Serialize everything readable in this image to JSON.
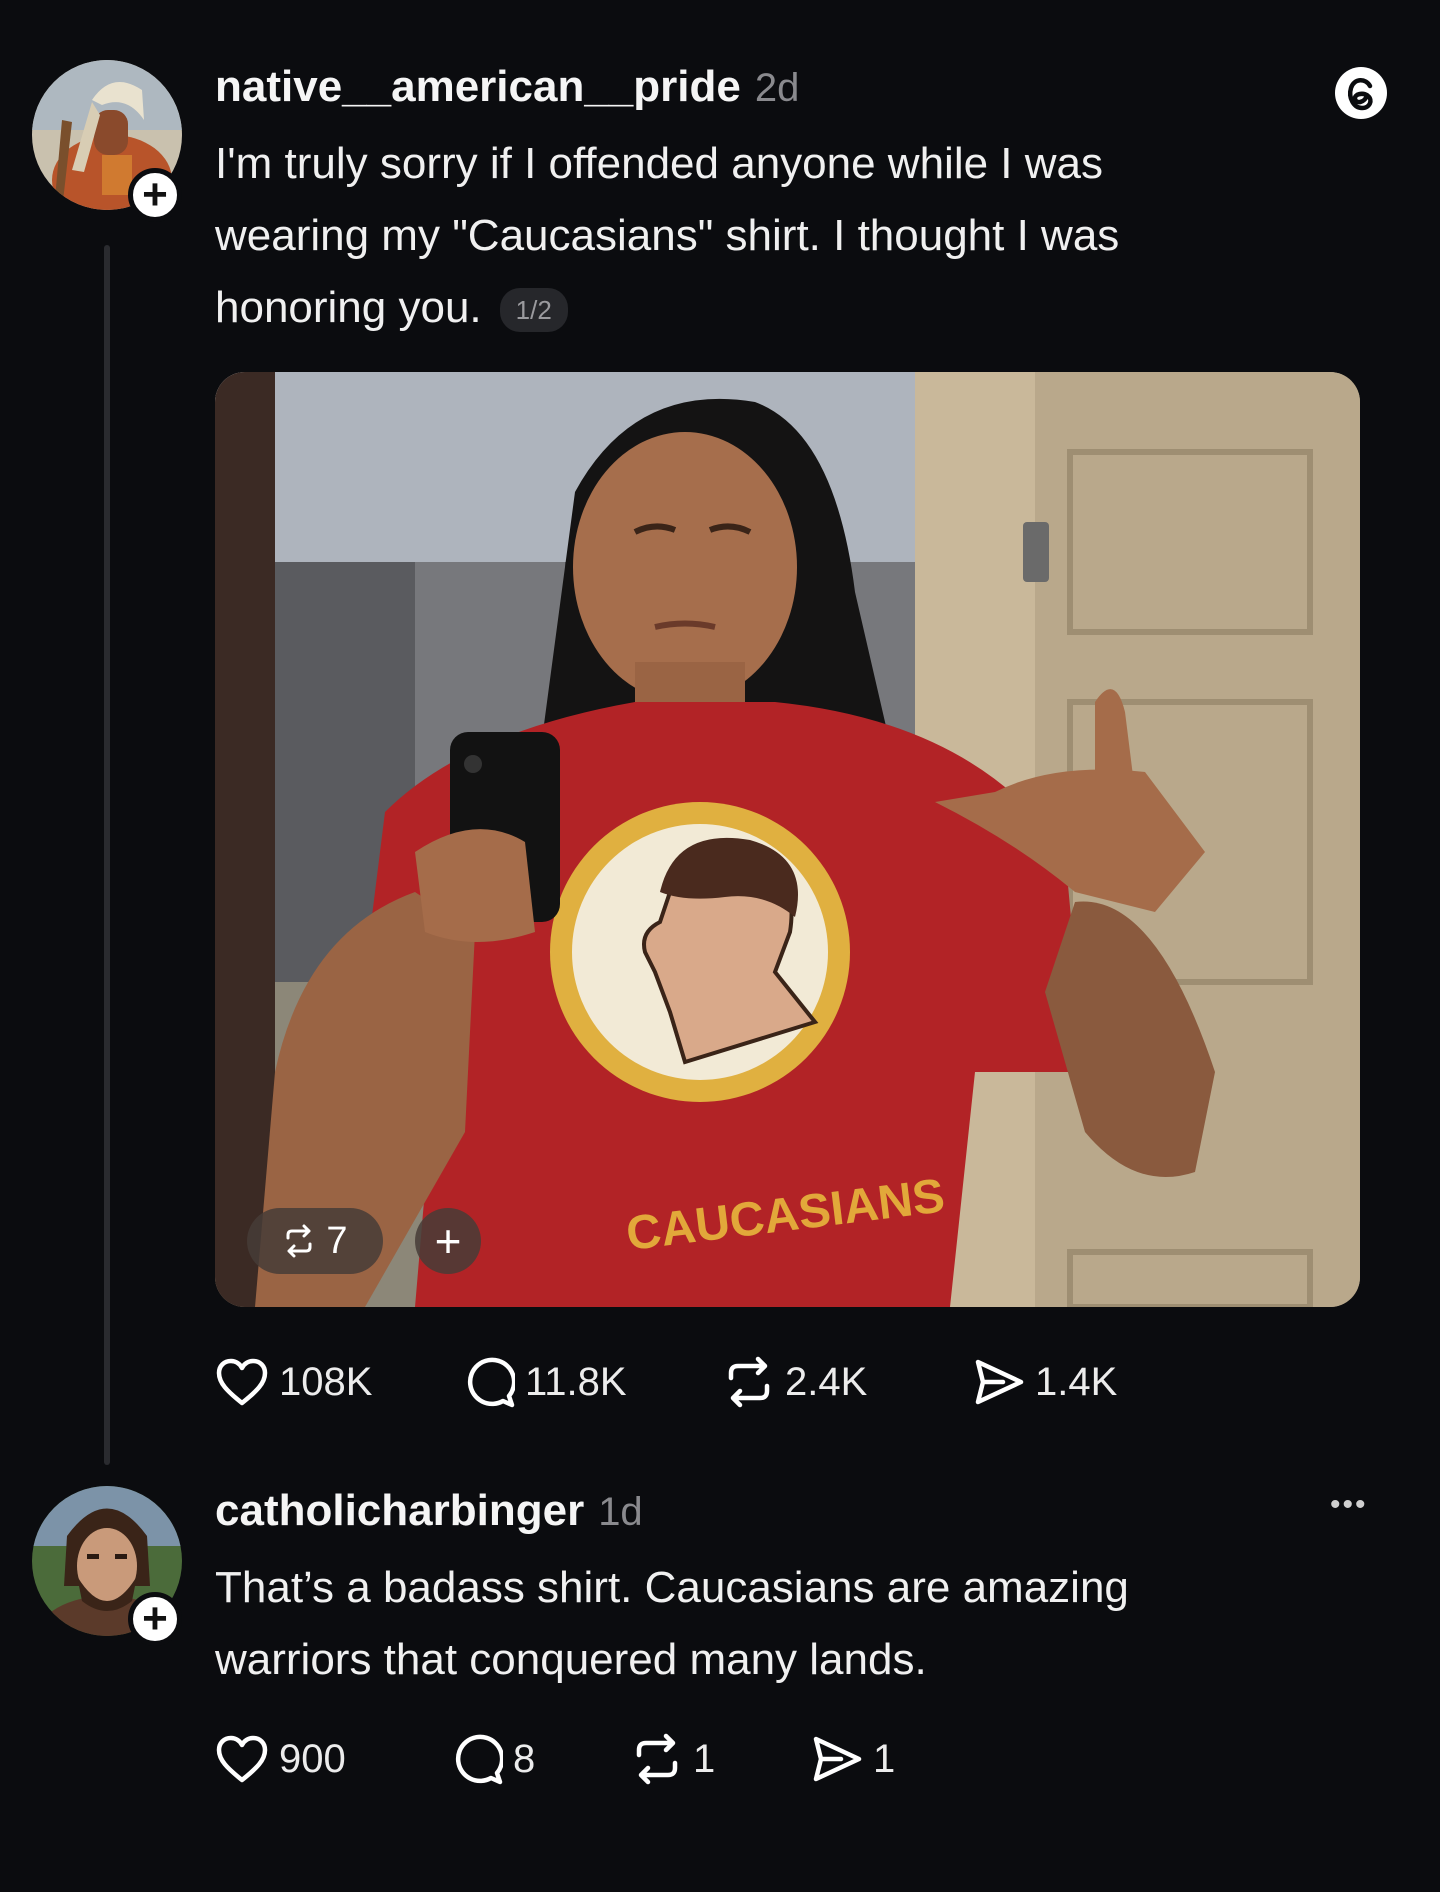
{
  "post": {
    "username": "native__american__pride",
    "time": "2d",
    "text_lines": [
      "I'm truly sorry if I offended anyone while I was",
      "wearing my \"Caucasians\" shirt. I thought I was",
      "honoring you."
    ],
    "page_indicator": "1/2",
    "shirt_text": "CAUCASIANS",
    "media_repost_count": "7",
    "media_add_label": "+",
    "stats": {
      "likes": "108K",
      "replies": "11.8K",
      "reposts": "2.4K",
      "shares": "1.4K"
    }
  },
  "reply": {
    "username": "catholicharbinger",
    "time": "1d",
    "text_lines": [
      "That’s a badass shirt. Caucasians are amazing",
      "warriors that conquered many lands."
    ],
    "more_label": "•••",
    "stats": {
      "likes": "900",
      "replies": "8",
      "reposts": "1",
      "shares": "1"
    }
  },
  "follow_badge_label": "+",
  "icons": {
    "app": "threads-logo-icon",
    "like": "heart-icon",
    "reply": "comment-icon",
    "repost": "repost-icon",
    "share": "send-icon"
  }
}
